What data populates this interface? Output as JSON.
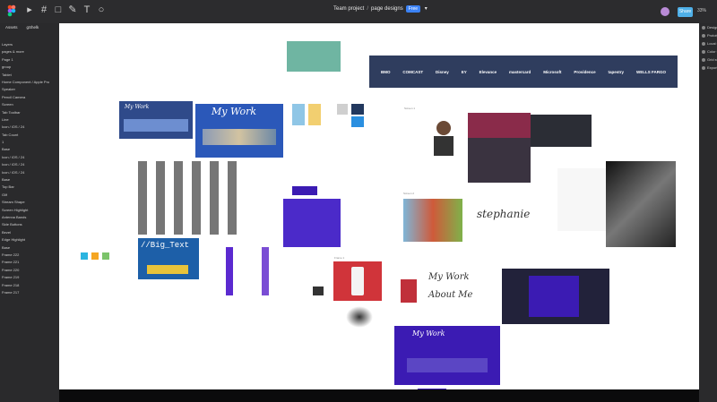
{
  "header": {
    "project": "Team project",
    "separator": "/",
    "file_name": "page designs",
    "plan_badge": "Free",
    "share_label": "Share",
    "zoom": "33%"
  },
  "left_panel": {
    "tabs": [
      "Assets",
      "gShelk"
    ],
    "layers": [
      "Layers",
      "pages & more",
      "Page 1",
      "group",
      "Tablet",
      "Home Component / Apple Pro",
      "Speaker",
      "Pencil Camera",
      "Screen",
      "Tab Toolbar",
      "Line",
      "Icon / iOS / 24",
      "Tab Count",
      "1",
      "Base",
      "Icon / iOS / 24",
      "Icon / iOS / 24",
      "Icon / iOS / 24",
      "Base",
      "Top Bar",
      "Glif",
      "Stream Shape",
      "Screen Highlight",
      "Antenna Bands",
      "Side Buttons",
      "Bezel",
      "Edge Highlight",
      "Base",
      "Frame 222",
      "Frame 221",
      "Frame 220",
      "Frame 219",
      "Frame 218",
      "Frame 217"
    ]
  },
  "right_panel": {
    "items": [
      "Design",
      "Prototype",
      "Local styles",
      "Color styles",
      "Grid styles",
      "Export"
    ]
  },
  "canvas": {
    "logos": [
      "BMO",
      "COMCAST",
      "Disney",
      "EY",
      "Elevance",
      "mastercard",
      "Microsoft",
      "Providence",
      "tapestry",
      "WELLS FARGO"
    ],
    "frame_labels": {
      "screen1": "Screen 1",
      "screen2": "Screen 2",
      "screen3": "Screen 3",
      "screen4": "Screen 4",
      "screen5": "Screen 5",
      "frame1": "Frame 1",
      "frame2": "Frame 2",
      "frame3": "Frame 3"
    },
    "big_text": "//Big_Text",
    "handwriting_1": "My Work",
    "handwriting_2": "About Me",
    "signature": "stephanie",
    "my_work_title": "My Work",
    "my_work_small": "My Work"
  },
  "colors": {
    "accent": "#4fb0e8",
    "purple": "#3b1bb3",
    "navy": "#2f3d5e",
    "red": "#d0343a"
  }
}
